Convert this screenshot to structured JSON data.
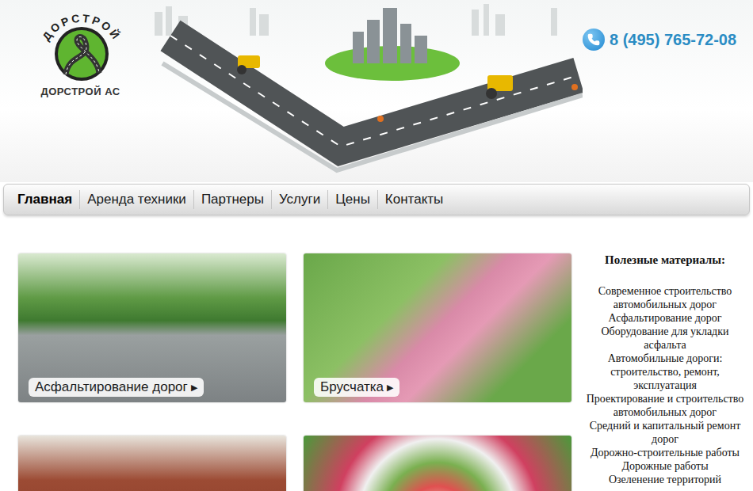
{
  "logo": {
    "arc": "ДОРСТРОЙ",
    "name": "ДОРСТРОЙ АС"
  },
  "phone": "8 (495) 765-72-08",
  "nav": [
    {
      "label": "Главная",
      "selected": true
    },
    {
      "label": "Аренда техники",
      "selected": false
    },
    {
      "label": "Партнеры",
      "selected": false
    },
    {
      "label": "Услуги",
      "selected": false
    },
    {
      "label": "Цены",
      "selected": false
    },
    {
      "label": "Контакты",
      "selected": false
    }
  ],
  "cards": [
    {
      "kind": "labeled",
      "label": "Асфальтирование дорог",
      "arrow": "▶"
    },
    {
      "kind": "labeled",
      "label": "Брусчатка",
      "arrow": "▶"
    },
    {
      "kind": "plain"
    },
    {
      "kind": "plain"
    }
  ],
  "sidebar": {
    "title": "Полезные материалы:",
    "links": [
      "Современное строительство автомобильных дорог",
      "Асфальтирование дорог",
      "Оборудование для укладки асфальта",
      "Автомобильные дороги: строительство, ремонт, эксплуатация",
      "Проектирование и строительство автомобильных дорог",
      "Средний и капитальный ремонт дорог",
      "Дорожно-строительные работы",
      "Дорожные работы",
      "Озеленение территорий"
    ]
  }
}
